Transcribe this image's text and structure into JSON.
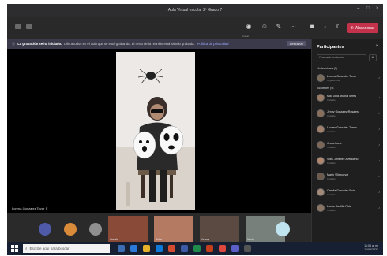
{
  "window": {
    "title": "Aula Virtual escolar 2º Grado 7"
  },
  "toolbar": {
    "record_label": "Grabar",
    "leave_label": "Abandonar"
  },
  "banner": {
    "strong_text": "La grabación se ha iniciado.",
    "text": "Dile a todos en el aula que se está grabando. El resto de la reunión está siendo grabada.",
    "link_text": "Política de privacidad",
    "dismiss_label": "Descartar"
  },
  "stage": {
    "spotlight_name": "Lorena Gonzalez Tovar"
  },
  "panel": {
    "title": "Participantes",
    "share_placeholder": "Compartir invitación",
    "organizers_label": "Moderadores (1)",
    "attendees_label": "Asistentes (9)",
    "organizer": {
      "name": "Lorena Gonzalez Tovar",
      "role": "Organizador"
    },
    "attendees": [
      {
        "name": "Mia Sofia Ariana Torres",
        "status": "Invitado"
      },
      {
        "name": "Jenny Gonzalez Rosales",
        "status": "Invitado"
      },
      {
        "name": "Lucero Gonzalez Torres",
        "status": "Invitado"
      },
      {
        "name": "Jesus Luna",
        "status": "Invitado"
      },
      {
        "name": "Sofia Jiménez Avendaño",
        "status": "Invitado"
      },
      {
        "name": "Mario Villanueva",
        "status": "Invitado"
      },
      {
        "name": "Camila Gonzalez Ruiz",
        "status": "Invitado"
      },
      {
        "name": "Lucas Castillo Ruiz",
        "status": "Invitado"
      }
    ]
  },
  "thumbnails": [
    {
      "name": "Camila"
    },
    {
      "name": "Sofia"
    },
    {
      "name": "Jesus"
    },
    {
      "name": "Mario"
    }
  ],
  "taskbar": {
    "search_placeholder": "Escribe aquí para buscar",
    "time": "11:05 a. m.",
    "date": "11/06/2021"
  },
  "colors": {
    "leave": "#c4314b",
    "panel_bg": "#1f1f1f",
    "stage_bg": "#000000",
    "taskbar": "#162032"
  }
}
